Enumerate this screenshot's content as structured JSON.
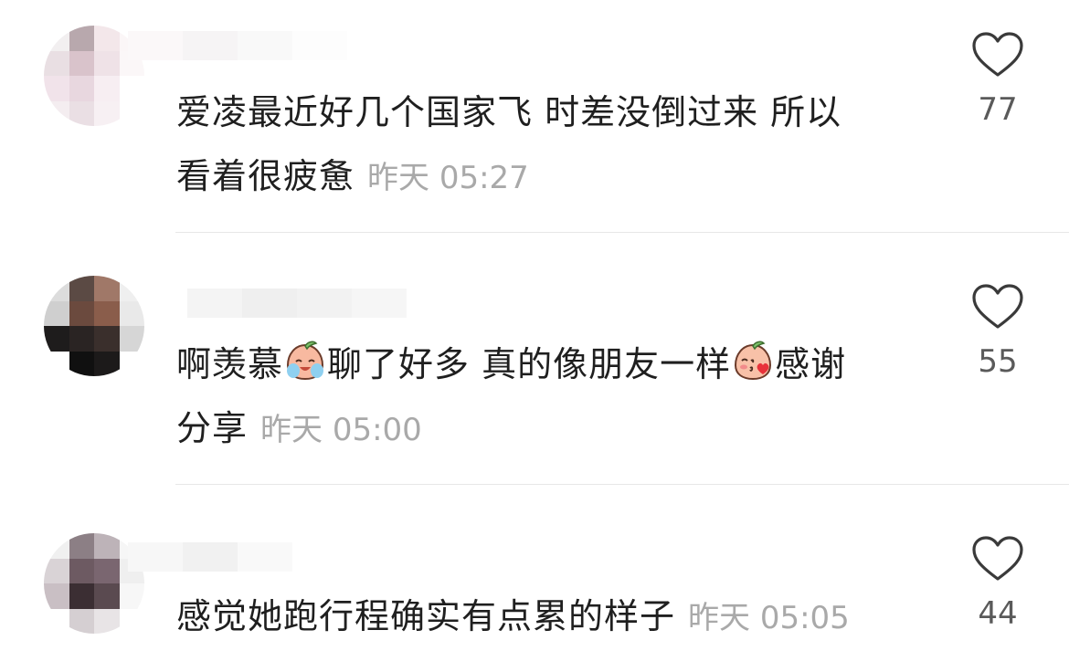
{
  "comments": [
    {
      "text_line1": "爱凌最近好几个国家飞 时差没倒过来 所以",
      "text_line2": "看着很疲惫",
      "time": "昨天 05:27",
      "likes": "77",
      "avatar_colors": [
        "#f2eff0",
        "#b8a8ad",
        "#f3e7ea",
        "#fbf6f7",
        "#e9dfe3",
        "#d9c3cb",
        "#efe2e7",
        "#fbf7f8",
        "#f1e3ea",
        "#e8d7df",
        "#f7eef2",
        "#ffffff",
        "#f4edf0",
        "#eadfe4",
        "#f7f0f3",
        "#ffffff"
      ]
    },
    {
      "text_seg1": "啊羡慕",
      "emoji1": "crying-peach-emoji",
      "text_seg2": "聊了好多 真的像朋友一样",
      "emoji2": "kiss-peach-emoji",
      "text_seg3": "感谢",
      "text_line2": "分享",
      "time": "昨天 05:00",
      "likes": "55",
      "avatar_colors": [
        "#dcdcdc",
        "#5b4a44",
        "#a07868",
        "#efefef",
        "#cfcfcf",
        "#6b4a3e",
        "#8a5d4b",
        "#e9e9e9",
        "#1e1c1c",
        "#2a2423",
        "#3a2f2c",
        "#d6d6d6",
        "#ffffff",
        "#101010",
        "#1c1a1a",
        "#ffffff"
      ]
    },
    {
      "text": "感觉她跑行程确实有点累的样子",
      "time": "昨天 05:05",
      "likes": "44",
      "avatar_colors": [
        "#f0f0f0",
        "#8c7f85",
        "#bdb3b8",
        "#f6f6f6",
        "#d9d3d6",
        "#6d5a62",
        "#7a6670",
        "#efefef",
        "#c9bfc4",
        "#3b2e33",
        "#5a4a50",
        "#f7f7f7",
        "#ffffff",
        "#d5cfd2",
        "#e8e4e6",
        "#ffffff"
      ]
    }
  ],
  "colors": {
    "text": "#1f1f1f",
    "time": "#a9a9a9",
    "like_count": "#5a5a5a",
    "divider": "#e7e7e7"
  }
}
